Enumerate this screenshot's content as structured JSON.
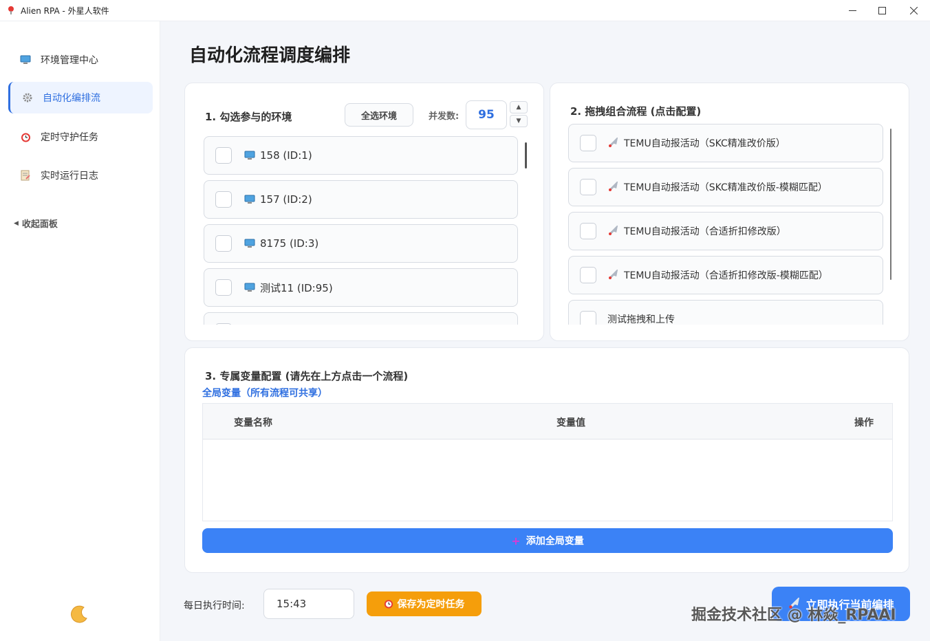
{
  "window": {
    "title": "Alien RPA - 外星人软件",
    "minimize": "—",
    "maximize": "☐",
    "close": "✕"
  },
  "sidebar": {
    "items": [
      {
        "label": "环境管理中心",
        "icon": "computer-icon",
        "active": false
      },
      {
        "label": "自动化编排流",
        "icon": "gear-icon",
        "active": true
      },
      {
        "label": "定时守护任务",
        "icon": "alarm-clock-icon",
        "active": false
      },
      {
        "label": "实时运行日志",
        "icon": "memo-icon",
        "active": false
      }
    ],
    "collapse_label": "收起面板",
    "theme_icon": "moon-icon"
  },
  "page": {
    "title": "自动化流程调度编排"
  },
  "env_section": {
    "title": "1. 勾选参与的环境",
    "select_all_label": "全选环境",
    "concurrency_label": "并发数:",
    "concurrency_value": "95",
    "environments": [
      {
        "label": "158 (ID:1)",
        "checked": false
      },
      {
        "label": "157 (ID:2)",
        "checked": false
      },
      {
        "label": "8175 (ID:3)",
        "checked": false
      },
      {
        "label": "测试11 (ID:95)",
        "checked": false
      }
    ]
  },
  "flow_section": {
    "title": "2. 拖拽组合流程 (点击配置)",
    "flows": [
      {
        "label": "TEMU自动报活动（SKC精准改价版）",
        "icon": "rocket-icon"
      },
      {
        "label": "TEMU自动报活动（SKC精准改价版-模糊匹配）",
        "icon": "rocket-icon"
      },
      {
        "label": "TEMU自动报活动（合适折扣修改版）",
        "icon": "rocket-icon"
      },
      {
        "label": "TEMU自动报活动（合适折扣修改版-模糊匹配）",
        "icon": "rocket-icon"
      },
      {
        "label": "测试拖拽和上传",
        "icon": ""
      }
    ]
  },
  "var_section": {
    "title": "3. 专属变量配置 (请先在上方点击一个流程)",
    "global_link": "全局变量（所有流程可共享）",
    "columns": [
      "变量名称",
      "变量值",
      "操作"
    ],
    "rows": [],
    "add_button": "添加全局变量"
  },
  "footer": {
    "time_label": "每日执行时间:",
    "time_value": "15:43",
    "save_button": "保存为定时任务",
    "run_button": "立即执行当前编排"
  },
  "watermark": "掘金技术社区 @ 林焱_RPAAI",
  "colors": {
    "accent": "#3b82f6",
    "active_text": "#2f6fe0",
    "warning": "#f59e0b"
  }
}
